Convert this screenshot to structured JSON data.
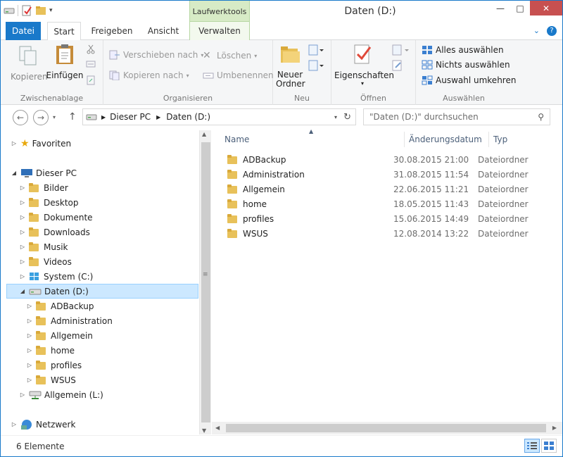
{
  "window": {
    "title": "Daten (D:)",
    "contextual_tab": "Laufwerktools",
    "controls": {
      "minimize": "—",
      "maximize": "□",
      "close": "✕"
    }
  },
  "ribbon_tabs": [
    {
      "label": "Datei"
    },
    {
      "label": "Start"
    },
    {
      "label": "Freigeben"
    },
    {
      "label": "Ansicht"
    },
    {
      "label": "Verwalten"
    }
  ],
  "ribbon": {
    "clipboard": {
      "label": "Zwischenablage",
      "copy": "Kopieren",
      "paste": "Einfügen"
    },
    "organize": {
      "label": "Organisieren",
      "move_to": "Verschieben nach",
      "copy_to": "Kopieren nach",
      "delete": "Löschen",
      "rename": "Umbenennen"
    },
    "new": {
      "label": "Neu",
      "new_folder_line1": "Neuer",
      "new_folder_line2": "Ordner"
    },
    "open": {
      "label": "Öffnen",
      "properties": "Eigenschaften"
    },
    "select": {
      "label": "Auswählen",
      "select_all": "Alles auswählen",
      "select_none": "Nichts auswählen",
      "invert": "Auswahl umkehren"
    }
  },
  "addressbar": {
    "crumbs": [
      "Dieser PC",
      "Daten (D:)"
    ],
    "search_placeholder": "\"Daten (D:)\" durchsuchen"
  },
  "tree": {
    "favorites": "Favoriten",
    "this_pc": "Dieser PC",
    "pc_items": [
      "Bilder",
      "Desktop",
      "Dokumente",
      "Downloads",
      "Musik",
      "Videos",
      "System (C:)"
    ],
    "selected_drive": "Daten (D:)",
    "drive_children": [
      "ADBackup",
      "Administration",
      "Allgemein",
      "home",
      "profiles",
      "WSUS"
    ],
    "network_drive": "Allgemein (L:)",
    "network": "Netzwerk"
  },
  "list": {
    "columns": [
      "Name",
      "Änderungsdatum",
      "Typ"
    ],
    "rows": [
      {
        "name": "ADBackup",
        "date": "30.08.2015 21:00",
        "type": "Dateiordner"
      },
      {
        "name": "Administration",
        "date": "31.08.2015 11:54",
        "type": "Dateiordner"
      },
      {
        "name": "Allgemein",
        "date": "22.06.2015 11:21",
        "type": "Dateiordner"
      },
      {
        "name": "home",
        "date": "18.05.2015 11:43",
        "type": "Dateiordner"
      },
      {
        "name": "profiles",
        "date": "15.06.2015 14:49",
        "type": "Dateiordner"
      },
      {
        "name": "WSUS",
        "date": "12.08.2014 13:22",
        "type": "Dateiordner"
      }
    ]
  },
  "status": {
    "count": "6 Elemente"
  }
}
